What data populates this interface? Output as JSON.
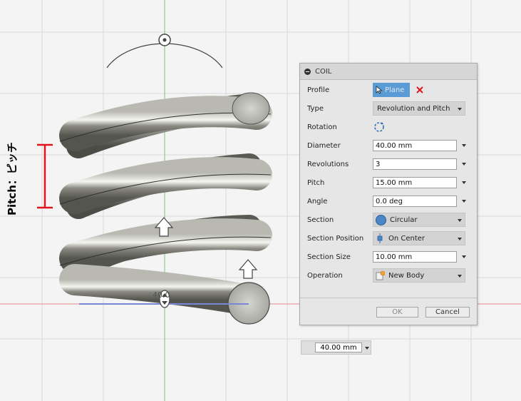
{
  "annotation": {
    "pitch_label": "Pitch：ピッチ"
  },
  "viewport": {
    "dimension_readout": "40.0"
  },
  "dialog": {
    "title": "COIL",
    "rows": [
      {
        "label": "Profile",
        "value": "Plane"
      },
      {
        "label": "Type",
        "value": "Revolution and Pitch"
      },
      {
        "label": "Rotation",
        "value": ""
      },
      {
        "label": "Diameter",
        "value": "40.00 mm"
      },
      {
        "label": "Revolutions",
        "value": "3"
      },
      {
        "label": "Pitch",
        "value": "15.00 mm"
      },
      {
        "label": "Angle",
        "value": "0.0 deg"
      },
      {
        "label": "Section",
        "value": "Circular"
      },
      {
        "label": "Section Position",
        "value": "On Center"
      },
      {
        "label": "Section Size",
        "value": "10.00 mm"
      },
      {
        "label": "Operation",
        "value": "New Body"
      }
    ],
    "ok_label": "OK",
    "cancel_label": "Cancel"
  },
  "bottom_input": {
    "value": "40.00 mm"
  },
  "colors": {
    "select_blue": "#5b9bd5",
    "red": "#e0141c",
    "axis_green": "#7cc47c",
    "axis_red": "#e68a8a",
    "guide_blue": "#7b86d6"
  }
}
